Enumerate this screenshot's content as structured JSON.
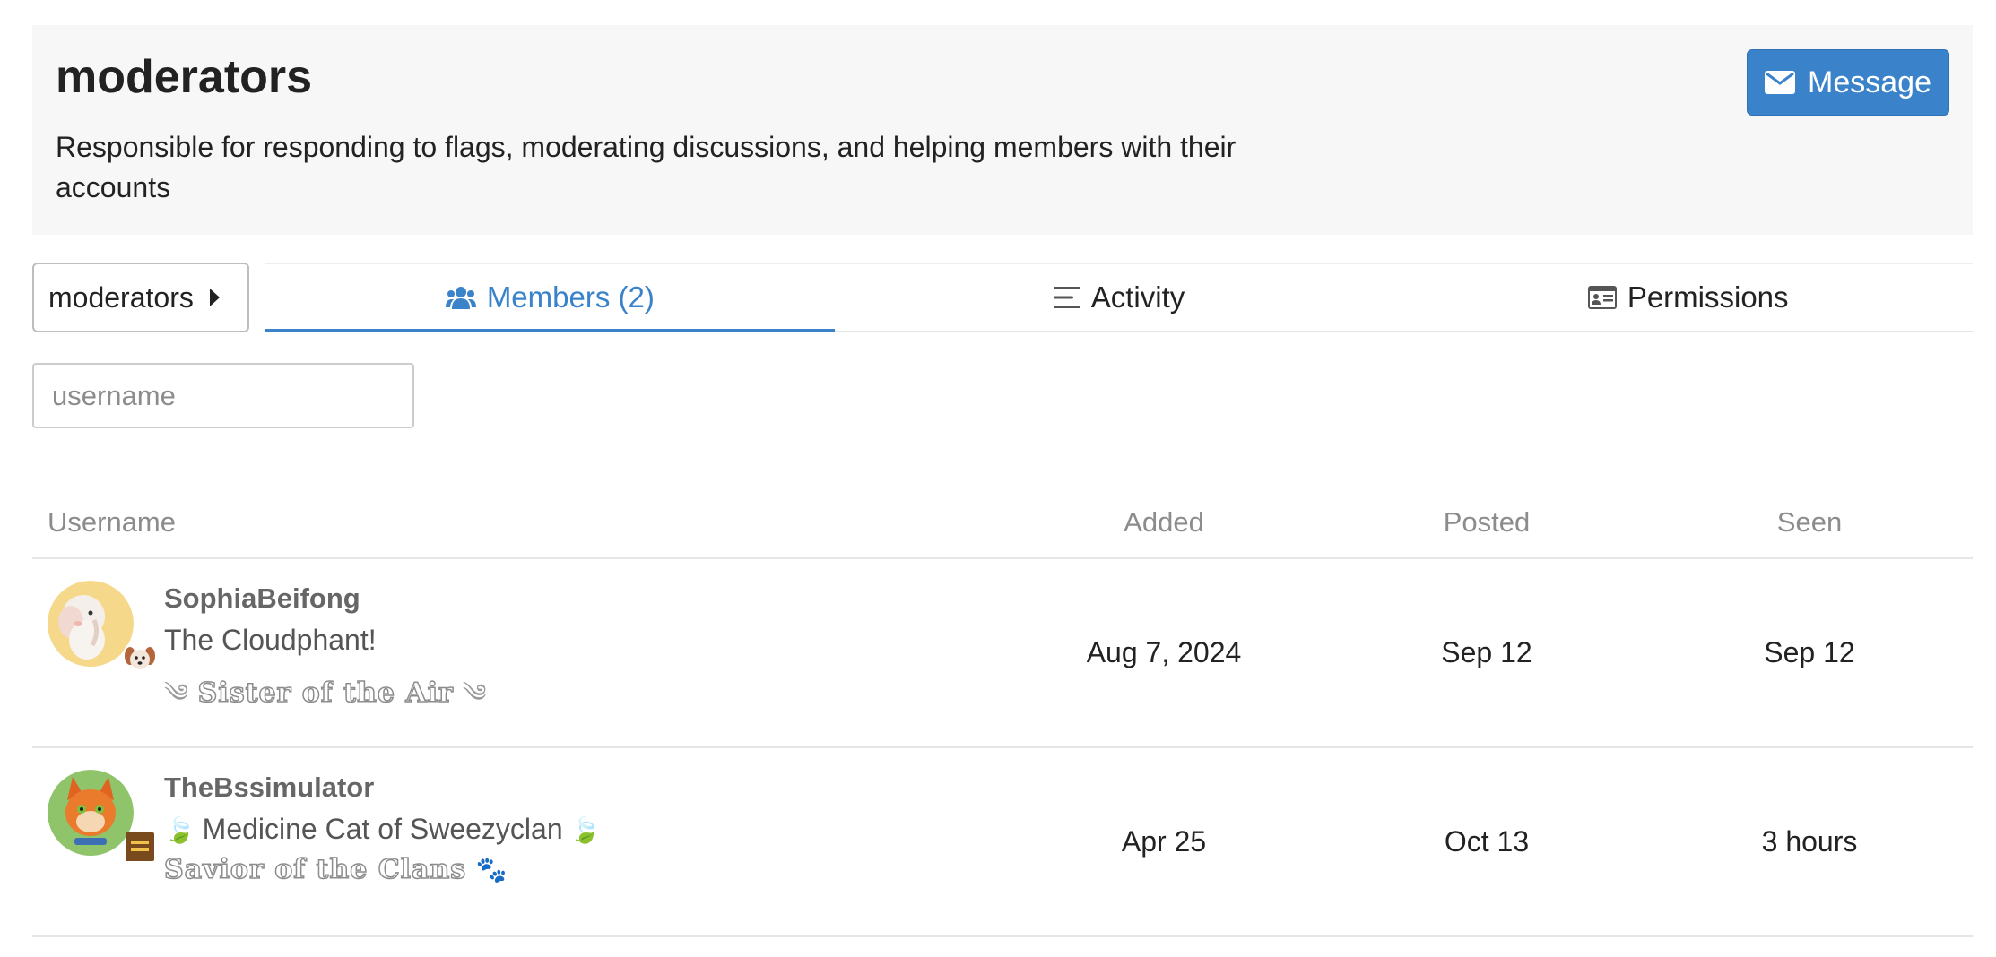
{
  "group": {
    "title": "moderators",
    "description": "Responsible for responding to flags, moderating discussions, and helping members with their accounts",
    "message_label": "Message",
    "message_icon": "envelope-icon"
  },
  "nav": {
    "dropdown_label": "moderators",
    "tabs": [
      {
        "label": "Members (2)",
        "icon": "users-icon",
        "active": true
      },
      {
        "label": "Activity",
        "icon": "list-icon",
        "active": false
      },
      {
        "label": "Permissions",
        "icon": "id-card-icon",
        "active": false
      }
    ]
  },
  "filter": {
    "placeholder": "username",
    "value": ""
  },
  "table": {
    "headers": {
      "username": "Username",
      "added": "Added",
      "posted": "Posted",
      "seen": "Seen"
    },
    "rows": [
      {
        "username": "SophiaBeifong",
        "title": "The Cloudphant!",
        "flair_text": "Sister of the Air",
        "added": "Aug 7, 2024",
        "posted": "Sep 12",
        "seen": "Sep 12"
      },
      {
        "username": "TheBssimulator",
        "title": "Medicine Cat of Sweezyclan",
        "flair_text": "Savior of the Clans",
        "added": "Apr 25",
        "posted": "Oct 13",
        "seen": "3 hours"
      }
    ]
  },
  "colors": {
    "accent": "#3a82c9",
    "header_bg": "#f7f7f7",
    "muted_text": "#8c8c8c"
  }
}
